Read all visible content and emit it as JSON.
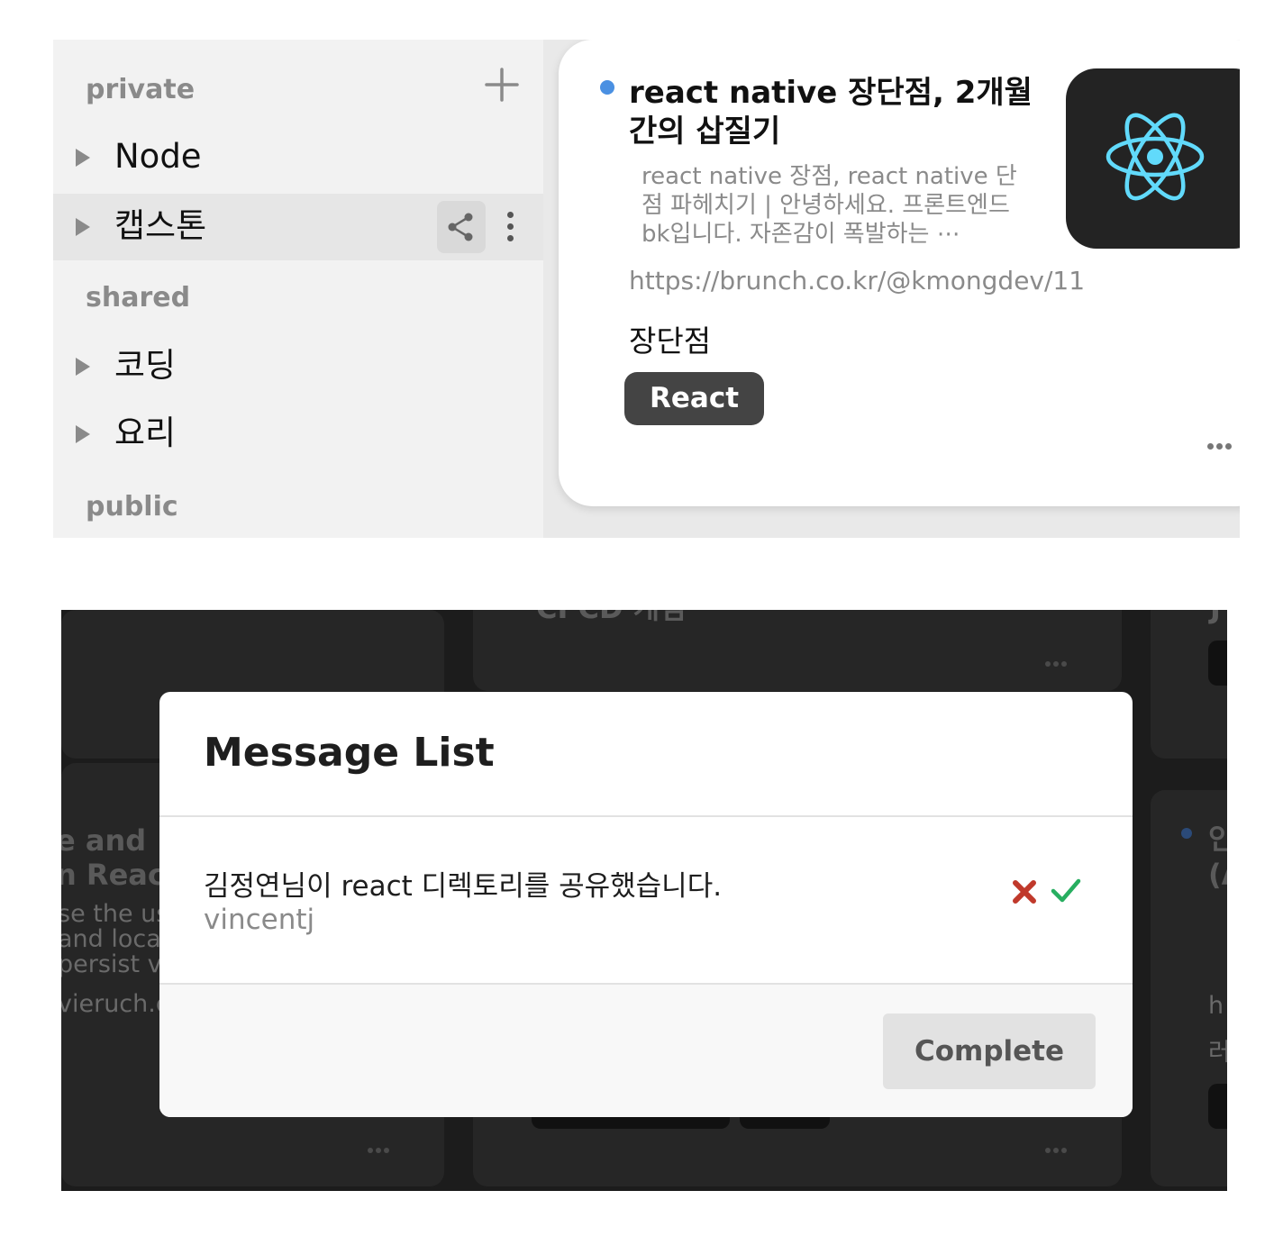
{
  "sidebar": {
    "sections": {
      "private": "private",
      "shared": "shared",
      "public": "public"
    },
    "add_icon": "plus-icon",
    "items": [
      {
        "label": "Node"
      },
      {
        "label": "캡스톤"
      },
      {
        "label": "코딩"
      },
      {
        "label": "요리"
      }
    ]
  },
  "card": {
    "title": "react native 장단점, 2개월 간의 삽질기",
    "description": "react native 장점, react native 단점 파헤치기 | 안녕하세요. 프론트엔드 bk입니다. 자존감이 폭발하는 ⋯",
    "url": "https://brunch.co.kr/@kmongdev/11",
    "memo": "장단점",
    "tag": "React",
    "thumbnail_icon": "react-logo-icon",
    "colors": {
      "unread_dot": "#4a90e2",
      "tag_bg": "#444444",
      "thumb_bg": "#232323",
      "react_blue": "#61dafb"
    }
  },
  "background": {
    "texts": [
      "CI CD 개념",
      "e and",
      "n Reac",
      "se the us",
      "and loca",
      "persist v",
      "vieruch.c",
      "J",
      "인",
      "(A",
      "h",
      "러"
    ]
  },
  "modal": {
    "title": "Message List",
    "message": {
      "text": "김정연님이 react 디렉토리를 공유했습니다.",
      "sender": "vincentj"
    },
    "colors": {
      "reject": "#c0392b",
      "accept": "#27ae60"
    },
    "complete_label": "Complete"
  }
}
